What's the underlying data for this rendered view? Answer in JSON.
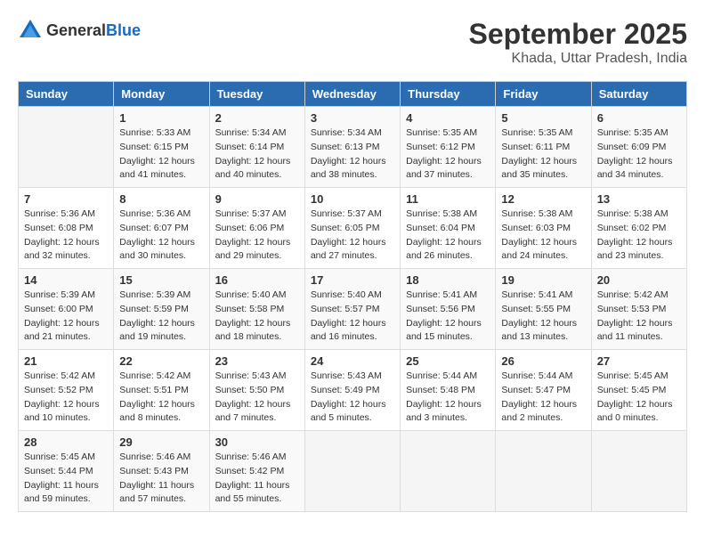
{
  "header": {
    "logo_general": "General",
    "logo_blue": "Blue",
    "month_year": "September 2025",
    "location": "Khada, Uttar Pradesh, India"
  },
  "weekdays": [
    "Sunday",
    "Monday",
    "Tuesday",
    "Wednesday",
    "Thursday",
    "Friday",
    "Saturday"
  ],
  "weeks": [
    [
      {
        "day": "",
        "sunrise": "",
        "sunset": "",
        "daylight": ""
      },
      {
        "day": "1",
        "sunrise": "Sunrise: 5:33 AM",
        "sunset": "Sunset: 6:15 PM",
        "daylight": "Daylight: 12 hours and 41 minutes."
      },
      {
        "day": "2",
        "sunrise": "Sunrise: 5:34 AM",
        "sunset": "Sunset: 6:14 PM",
        "daylight": "Daylight: 12 hours and 40 minutes."
      },
      {
        "day": "3",
        "sunrise": "Sunrise: 5:34 AM",
        "sunset": "Sunset: 6:13 PM",
        "daylight": "Daylight: 12 hours and 38 minutes."
      },
      {
        "day": "4",
        "sunrise": "Sunrise: 5:35 AM",
        "sunset": "Sunset: 6:12 PM",
        "daylight": "Daylight: 12 hours and 37 minutes."
      },
      {
        "day": "5",
        "sunrise": "Sunrise: 5:35 AM",
        "sunset": "Sunset: 6:11 PM",
        "daylight": "Daylight: 12 hours and 35 minutes."
      },
      {
        "day": "6",
        "sunrise": "Sunrise: 5:35 AM",
        "sunset": "Sunset: 6:09 PM",
        "daylight": "Daylight: 12 hours and 34 minutes."
      }
    ],
    [
      {
        "day": "7",
        "sunrise": "Sunrise: 5:36 AM",
        "sunset": "Sunset: 6:08 PM",
        "daylight": "Daylight: 12 hours and 32 minutes."
      },
      {
        "day": "8",
        "sunrise": "Sunrise: 5:36 AM",
        "sunset": "Sunset: 6:07 PM",
        "daylight": "Daylight: 12 hours and 30 minutes."
      },
      {
        "day": "9",
        "sunrise": "Sunrise: 5:37 AM",
        "sunset": "Sunset: 6:06 PM",
        "daylight": "Daylight: 12 hours and 29 minutes."
      },
      {
        "day": "10",
        "sunrise": "Sunrise: 5:37 AM",
        "sunset": "Sunset: 6:05 PM",
        "daylight": "Daylight: 12 hours and 27 minutes."
      },
      {
        "day": "11",
        "sunrise": "Sunrise: 5:38 AM",
        "sunset": "Sunset: 6:04 PM",
        "daylight": "Daylight: 12 hours and 26 minutes."
      },
      {
        "day": "12",
        "sunrise": "Sunrise: 5:38 AM",
        "sunset": "Sunset: 6:03 PM",
        "daylight": "Daylight: 12 hours and 24 minutes."
      },
      {
        "day": "13",
        "sunrise": "Sunrise: 5:38 AM",
        "sunset": "Sunset: 6:02 PM",
        "daylight": "Daylight: 12 hours and 23 minutes."
      }
    ],
    [
      {
        "day": "14",
        "sunrise": "Sunrise: 5:39 AM",
        "sunset": "Sunset: 6:00 PM",
        "daylight": "Daylight: 12 hours and 21 minutes."
      },
      {
        "day": "15",
        "sunrise": "Sunrise: 5:39 AM",
        "sunset": "Sunset: 5:59 PM",
        "daylight": "Daylight: 12 hours and 19 minutes."
      },
      {
        "day": "16",
        "sunrise": "Sunrise: 5:40 AM",
        "sunset": "Sunset: 5:58 PM",
        "daylight": "Daylight: 12 hours and 18 minutes."
      },
      {
        "day": "17",
        "sunrise": "Sunrise: 5:40 AM",
        "sunset": "Sunset: 5:57 PM",
        "daylight": "Daylight: 12 hours and 16 minutes."
      },
      {
        "day": "18",
        "sunrise": "Sunrise: 5:41 AM",
        "sunset": "Sunset: 5:56 PM",
        "daylight": "Daylight: 12 hours and 15 minutes."
      },
      {
        "day": "19",
        "sunrise": "Sunrise: 5:41 AM",
        "sunset": "Sunset: 5:55 PM",
        "daylight": "Daylight: 12 hours and 13 minutes."
      },
      {
        "day": "20",
        "sunrise": "Sunrise: 5:42 AM",
        "sunset": "Sunset: 5:53 PM",
        "daylight": "Daylight: 12 hours and 11 minutes."
      }
    ],
    [
      {
        "day": "21",
        "sunrise": "Sunrise: 5:42 AM",
        "sunset": "Sunset: 5:52 PM",
        "daylight": "Daylight: 12 hours and 10 minutes."
      },
      {
        "day": "22",
        "sunrise": "Sunrise: 5:42 AM",
        "sunset": "Sunset: 5:51 PM",
        "daylight": "Daylight: 12 hours and 8 minutes."
      },
      {
        "day": "23",
        "sunrise": "Sunrise: 5:43 AM",
        "sunset": "Sunset: 5:50 PM",
        "daylight": "Daylight: 12 hours and 7 minutes."
      },
      {
        "day": "24",
        "sunrise": "Sunrise: 5:43 AM",
        "sunset": "Sunset: 5:49 PM",
        "daylight": "Daylight: 12 hours and 5 minutes."
      },
      {
        "day": "25",
        "sunrise": "Sunrise: 5:44 AM",
        "sunset": "Sunset: 5:48 PM",
        "daylight": "Daylight: 12 hours and 3 minutes."
      },
      {
        "day": "26",
        "sunrise": "Sunrise: 5:44 AM",
        "sunset": "Sunset: 5:47 PM",
        "daylight": "Daylight: 12 hours and 2 minutes."
      },
      {
        "day": "27",
        "sunrise": "Sunrise: 5:45 AM",
        "sunset": "Sunset: 5:45 PM",
        "daylight": "Daylight: 12 hours and 0 minutes."
      }
    ],
    [
      {
        "day": "28",
        "sunrise": "Sunrise: 5:45 AM",
        "sunset": "Sunset: 5:44 PM",
        "daylight": "Daylight: 11 hours and 59 minutes."
      },
      {
        "day": "29",
        "sunrise": "Sunrise: 5:46 AM",
        "sunset": "Sunset: 5:43 PM",
        "daylight": "Daylight: 11 hours and 57 minutes."
      },
      {
        "day": "30",
        "sunrise": "Sunrise: 5:46 AM",
        "sunset": "Sunset: 5:42 PM",
        "daylight": "Daylight: 11 hours and 55 minutes."
      },
      {
        "day": "",
        "sunrise": "",
        "sunset": "",
        "daylight": ""
      },
      {
        "day": "",
        "sunrise": "",
        "sunset": "",
        "daylight": ""
      },
      {
        "day": "",
        "sunrise": "",
        "sunset": "",
        "daylight": ""
      },
      {
        "day": "",
        "sunrise": "",
        "sunset": "",
        "daylight": ""
      }
    ]
  ]
}
